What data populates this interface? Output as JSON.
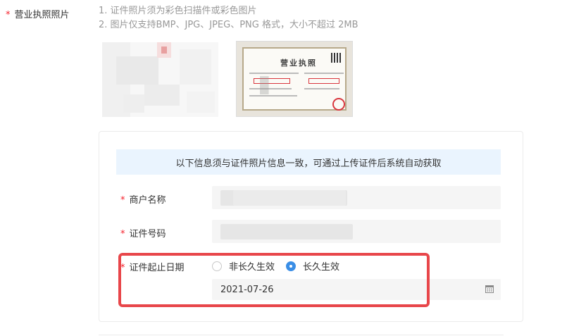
{
  "business_license": {
    "label": "营业执照照片",
    "required_mark": "*",
    "hints": [
      "1. 证件照片须为彩色扫描件或彩色图片",
      "2. 图片仅支持BMP、JPG、JPEG、PNG 格式，大小不超过 2MB"
    ],
    "license_title": "营业执照"
  },
  "info_panel": {
    "notice": "以下信息须与证件照片信息一致，可通过上传证件后系统自动获取",
    "merchant_name_label": "商户名称",
    "license_number_label": "证件号码",
    "validity_label": "证件起止日期",
    "required_mark": "*",
    "validity_options": [
      {
        "label": "非长久生效",
        "checked": false
      },
      {
        "label": "长久生效",
        "checked": true
      }
    ],
    "date_value": "2021-07-26"
  },
  "colors": {
    "accent": "#3a8ee6",
    "required": "#f5222d",
    "highlight": "#e8464a",
    "notice_bg": "#eaf4fe"
  },
  "icons": {
    "calendar": "calendar-icon"
  }
}
